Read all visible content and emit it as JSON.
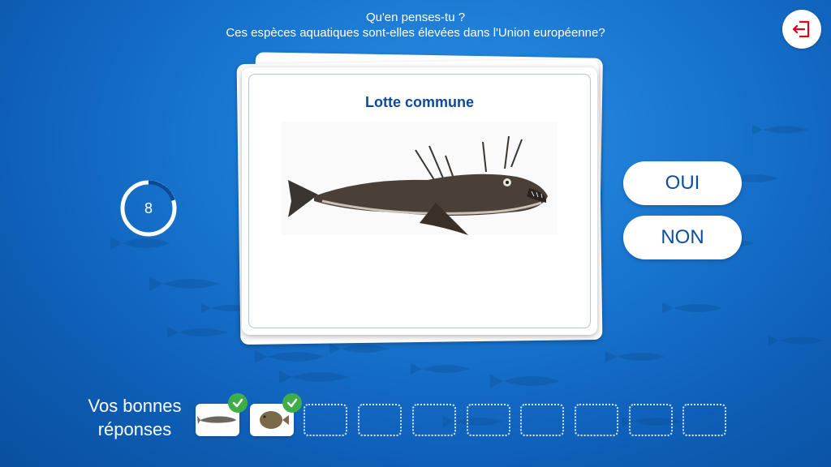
{
  "header": {
    "line1": "Qu'en penses-tu ?",
    "line2": "Ces espèces aquatiques sont-elles élevées dans l'Union européenne?"
  },
  "timer": {
    "value": "8",
    "fraction_remaining": 0.2
  },
  "card": {
    "title": "Lotte commune",
    "image": "anglerfish-illustration"
  },
  "buttons": {
    "yes_label": "OUI",
    "no_label": "NON"
  },
  "answers": {
    "label_line1": "Vos bonnes",
    "label_line2": "réponses",
    "slots": [
      {
        "state": "correct",
        "image": "sturgeon-thumbnail"
      },
      {
        "state": "correct",
        "image": "flatfish-thumbnail"
      },
      {
        "state": "empty"
      },
      {
        "state": "empty"
      },
      {
        "state": "empty"
      },
      {
        "state": "empty"
      },
      {
        "state": "empty"
      },
      {
        "state": "empty"
      },
      {
        "state": "empty"
      },
      {
        "state": "empty"
      }
    ]
  },
  "colors": {
    "ocean": "#1a78d2",
    "accent_red": "#e2001a",
    "title_blue": "#0b4a9b",
    "check_green": "#3fae49"
  },
  "icons": {
    "exit": "exit-icon",
    "check": "check-icon"
  }
}
